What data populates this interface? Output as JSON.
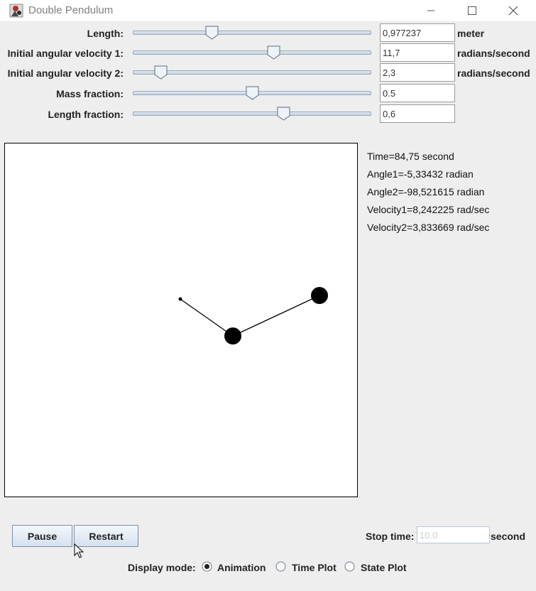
{
  "window": {
    "title": "Double Pendulum",
    "icon": "pendulum-app-icon"
  },
  "params": [
    {
      "label": "Length:",
      "value": "0,977237",
      "unit": "meter",
      "slider_fraction": 0.33
    },
    {
      "label": "Initial angular velocity 1:",
      "value": "11,7",
      "unit": "radians/second",
      "slider_fraction": 0.59
    },
    {
      "label": "Initial angular velocity 2:",
      "value": "2,3",
      "unit": "radians/second",
      "slider_fraction": 0.115
    },
    {
      "label": "Mass fraction:",
      "value": "0.5",
      "unit": "",
      "slider_fraction": 0.5
    },
    {
      "label": "Length fraction:",
      "value": "0,6",
      "unit": "",
      "slider_fraction": 0.63
    }
  ],
  "info": {
    "time": "Time=84,75 second",
    "angle1": "Angle1=-5,33432 radian",
    "angle2": "Angle2=-98,521615 radian",
    "velocity1": "Velocity1=8,242225 rad/sec",
    "velocity2": "Velocity2=3,833669 rad/sec"
  },
  "controls": {
    "pause_label": "Pause",
    "restart_label": "Restart",
    "stop_time_label": "Stop time:",
    "stop_time_placeholder": "10.0",
    "stop_time_unit": "second"
  },
  "display_mode": {
    "label": "Display mode:",
    "options": [
      {
        "label": "Animation",
        "selected": true
      },
      {
        "label": "Time Plot",
        "selected": false
      },
      {
        "label": "State Plot",
        "selected": false
      }
    ]
  },
  "colors": {
    "accent": "#7a8ea8",
    "canvas_bg": "#ffffff",
    "pendulum": "#000000"
  }
}
